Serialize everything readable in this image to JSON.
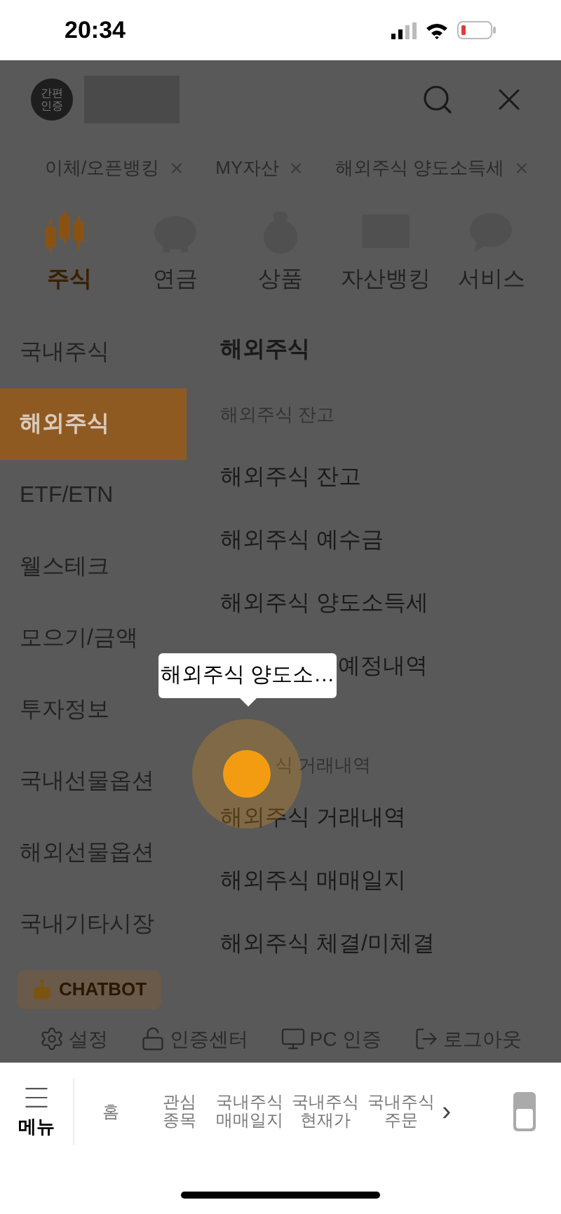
{
  "status_bar": {
    "time": "20:34"
  },
  "header": {
    "avatar_lines": [
      "간편",
      "인증"
    ]
  },
  "recent_tabs": [
    {
      "label": "이체/오픈뱅킹"
    },
    {
      "label": "MY자산"
    },
    {
      "label": "해외주식 양도소득세"
    }
  ],
  "categories": [
    {
      "label": "주식",
      "selected": true,
      "kind": "candles"
    },
    {
      "label": "연금",
      "selected": false,
      "kind": "piggy"
    },
    {
      "label": "상품",
      "selected": false,
      "kind": "bag"
    },
    {
      "label": "자산뱅킹",
      "selected": false,
      "kind": "monitor"
    },
    {
      "label": "서비스",
      "selected": false,
      "kind": "chat"
    }
  ],
  "sidebar": {
    "items": [
      {
        "label": "국내주식",
        "selected": false
      },
      {
        "label": "해외주식",
        "selected": true
      },
      {
        "label": "ETF/ETN",
        "selected": false
      },
      {
        "label": "웰스테크",
        "selected": false
      },
      {
        "label": "모으기/금액",
        "selected": false
      },
      {
        "label": "투자정보",
        "selected": false
      },
      {
        "label": "국내선물옵션",
        "selected": false
      },
      {
        "label": "해외선물옵션",
        "selected": false
      },
      {
        "label": "국내기타시장",
        "selected": false
      }
    ]
  },
  "panel": {
    "title": "해외주식",
    "sections": [
      {
        "heading": "해외주식 잔고",
        "heading_covered": false,
        "items": [
          {
            "label": "해외주식 잔고",
            "kind": "link"
          },
          {
            "label": "해외주식 예수금",
            "kind": "link"
          },
          {
            "label": "해외주식 양도소득세",
            "kind": "link"
          },
          {
            "label": "예정내역",
            "kind": "covered"
          }
        ]
      },
      {
        "heading": "식 거래내역",
        "heading_covered": true,
        "items": [
          {
            "label": "해외주식 거래내역",
            "kind": "link"
          },
          {
            "label": "해외주식 매매일지",
            "kind": "link"
          },
          {
            "label": "해외주식 체결/미체결",
            "kind": "link"
          }
        ]
      }
    ]
  },
  "tooltip": {
    "text": "해외주식 양도소…"
  },
  "chatbot": {
    "label": "CHATBOT"
  },
  "footer_links": [
    {
      "label": "설정",
      "kind": "gear"
    },
    {
      "label": "인증센터",
      "kind": "lock"
    },
    {
      "label": "PC 인증",
      "kind": "monitor"
    },
    {
      "label": "로그아웃",
      "kind": "logout"
    }
  ],
  "bottom_nav": {
    "menu_label": "메뉴",
    "items": [
      {
        "lines": [
          "홈"
        ]
      },
      {
        "lines": [
          "관심",
          "종목"
        ]
      },
      {
        "lines": [
          "국내주식",
          "매매일지"
        ]
      },
      {
        "lines": [
          "국내주식",
          "현재가"
        ]
      },
      {
        "lines": [
          "국내주식",
          "주문"
        ]
      }
    ],
    "more": "›"
  }
}
